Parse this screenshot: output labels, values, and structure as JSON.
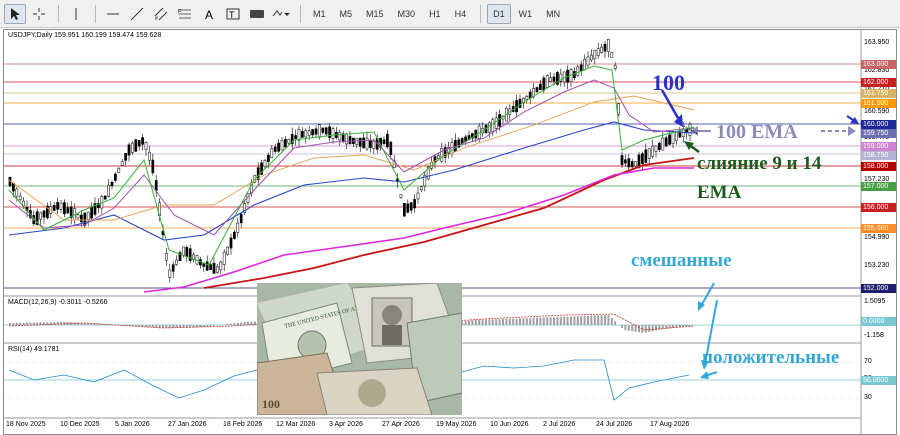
{
  "toolbar": {
    "timeframes": [
      "M1",
      "M5",
      "M15",
      "M30",
      "H1",
      "H4",
      "D1",
      "W1",
      "MN"
    ],
    "active_timeframe": "D1"
  },
  "chart_header": "USDJPY,Daily  159.951 160.199 159.474 159.628",
  "macd_label": "MACD(12,26,9) -0.3011 -0.5266",
  "rsi_label": "RSI(14) 49.1781",
  "price_axis": [
    "163.950",
    "162.830",
    "161.710",
    "160.590",
    "159.470",
    "157.230",
    "154.990",
    "153.230",
    "1.5095",
    "-1.158",
    "70",
    "50",
    "30"
  ],
  "price_tags": [
    {
      "text": "163.000",
      "color": "#c86464"
    },
    {
      "text": "162.000",
      "color": "#c81e1e"
    },
    {
      "text": "161.750",
      "color": "#d7b464"
    },
    {
      "text": "161.000",
      "color": "#ff9900"
    },
    {
      "text": "160.000",
      "color": "#1e2896"
    },
    {
      "text": "159.750",
      "color": "#6e6eb4"
    },
    {
      "text": "159.000",
      "color": "#d282d2"
    },
    {
      "text": "158.750",
      "color": "#b4b4d2"
    },
    {
      "text": "158.000",
      "color": "#b40000"
    },
    {
      "text": "157.000",
      "color": "#46a046"
    },
    {
      "text": "156.000",
      "color": "#c81e1e"
    },
    {
      "text": "155.000",
      "color": "#ff8c28"
    },
    {
      "text": "152.000",
      "color": "#1e1e6e"
    },
    {
      "text": "0.0000",
      "color": "#78c8d2"
    },
    {
      "text": "50.0000",
      "color": "#78c8d2"
    }
  ],
  "dates": [
    "18 Nov 2025",
    "10 Dec 2025",
    "5 Jan 2026",
    "27 Jan 2026",
    "18 Feb 2026",
    "12 Mar 2026",
    "3 Apr 2026",
    "27 Apr 2026",
    "19 May 2026",
    "10 Jun 2026",
    "2 Jul 2026",
    "24 Jul 2026",
    "17 Aug 2026"
  ],
  "annotations": {
    "label_100": "100",
    "label_ema100": "100 EMA",
    "label_merge_1": "слияние 9 и 14",
    "label_merge_2": "EMA",
    "label_mixed": "смешанные",
    "label_positive": "положительные"
  },
  "photo_text": "THE UNITED STATES OF AMERICA",
  "colors": {
    "ema100": "#2846c8",
    "ema200": "#c81414",
    "ema_magenta": "#dc28dc",
    "ema_orange": "#e6a050",
    "ema_green": "#32b432",
    "ema_purple": "#a050b4"
  }
}
